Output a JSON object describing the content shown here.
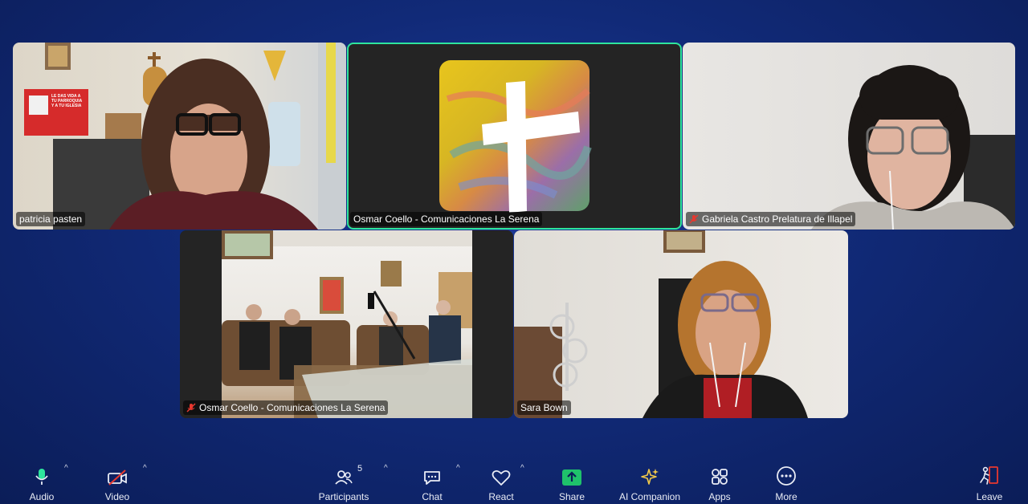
{
  "participants": {
    "patricia": {
      "name": "patricia pasten",
      "muted": false
    },
    "osmar_share": {
      "name": "Osmar Coello - Comunicaciones La Serena",
      "muted": false
    },
    "gabriela": {
      "name": "Gabriela Castro Prelatura de Illapel",
      "muted": true
    },
    "osmar_cam": {
      "name": "Osmar Coello - Comunicaciones La Serena",
      "muted": true
    },
    "sara": {
      "name": "Sara Bown",
      "muted": false
    }
  },
  "poster": {
    "text": "LE DAS VIDA A TU PARROQUIA Y A TU IGLESIA"
  },
  "toolbar": {
    "audio": "Audio",
    "video": "Video",
    "participants": "Participants",
    "participants_count": "5",
    "chat": "Chat",
    "react": "React",
    "share": "Share",
    "ai_companion": "AI Companion",
    "apps": "Apps",
    "more": "More",
    "leave": "Leave"
  },
  "colors": {
    "active_speaker_border": "#2ee59d",
    "share_green": "#1fc26b",
    "muted_red": "#e8382f",
    "background": "#112a78"
  },
  "icons": [
    "microphone-icon",
    "video-off-icon",
    "participants-icon",
    "chat-icon",
    "heart-icon",
    "share-screen-icon",
    "sparkle-icon",
    "apps-icon",
    "more-icon",
    "leave-icon"
  ]
}
